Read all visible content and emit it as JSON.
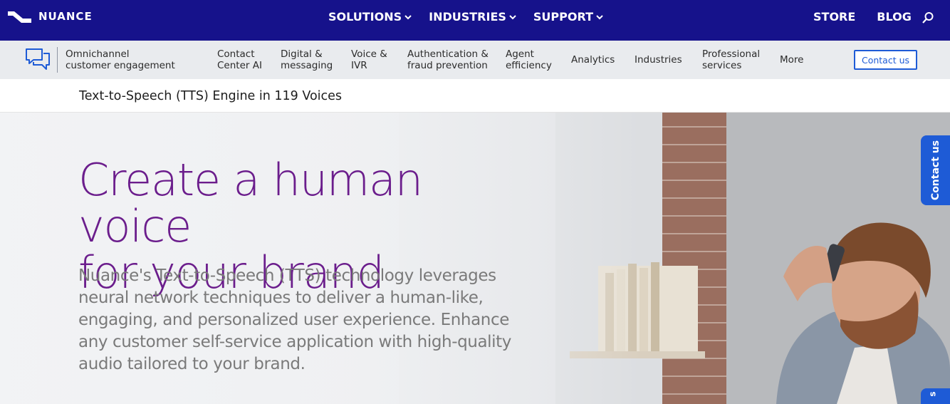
{
  "brand": {
    "logo_text": "NUANCE"
  },
  "main_nav": [
    {
      "label": "SOLUTIONS"
    },
    {
      "label": "INDUSTRIES"
    },
    {
      "label": "SUPPORT"
    }
  ],
  "right_nav": [
    {
      "label": "STORE"
    },
    {
      "label": "BLOG"
    }
  ],
  "subnav": {
    "title_line1": "Omnichannel",
    "title_line2": "customer engagement",
    "links": [
      {
        "line1": "Contact",
        "line2": "Center AI"
      },
      {
        "line1": "Digital &",
        "line2": "messaging"
      },
      {
        "line1": "Voice &",
        "line2": "IVR"
      },
      {
        "line1": "Authentication &",
        "line2": "fraud prevention"
      },
      {
        "line1": "Agent",
        "line2": "efficiency"
      },
      {
        "line1": "Analytics",
        "line2": ""
      },
      {
        "line1": "Industries",
        "line2": ""
      },
      {
        "line1": "Professional",
        "line2": "services"
      },
      {
        "line1": "More",
        "line2": ""
      }
    ],
    "contact_button": "Contact us"
  },
  "breadcrumb": {
    "title": "Text-to-Speech (TTS) Engine in 119 Voices"
  },
  "hero": {
    "headline_line1": "Create a human voice",
    "headline_line2": "for your brand",
    "body": "Nuance's Text-to-Speech (TTS) technology leverages neural network techniques to deliver a human-like, engaging, and personalized user experience. Enhance any customer self-service application with high-quality audio tailored to your brand."
  },
  "side_tabs": {
    "contact": "Contact us",
    "second": "s"
  },
  "colors": {
    "topbar": "#16128b",
    "accent": "#1e5bd6",
    "headline": "#6b1d8c"
  }
}
